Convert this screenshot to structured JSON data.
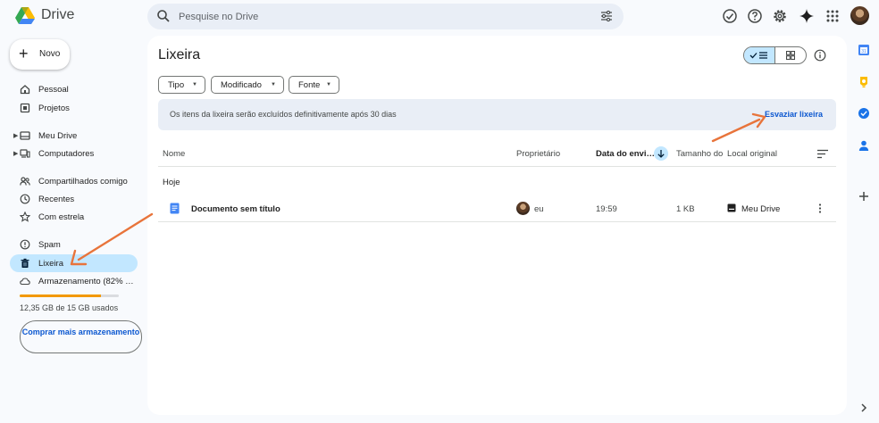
{
  "app": {
    "title": "Drive"
  },
  "search": {
    "placeholder": "Pesquise no Drive"
  },
  "topbar": {
    "icons": [
      "offline-status-icon",
      "help-icon",
      "settings-icon",
      "gemini-sparkle-icon",
      "apps-grid-icon",
      "account-avatar"
    ]
  },
  "sidebar": {
    "new_label": "Novo",
    "items": [
      {
        "label": "Pessoal",
        "icon": "home-icon"
      },
      {
        "label": "Projetos",
        "icon": "workspace-icon"
      },
      {
        "label": "Meu Drive",
        "icon": "my-drive-icon"
      },
      {
        "label": "Computadores",
        "icon": "computers-icon"
      },
      {
        "label": "Compartilhados comigo",
        "icon": "shared-icon"
      },
      {
        "label": "Recentes",
        "icon": "clock-icon"
      },
      {
        "label": "Com estrela",
        "icon": "star-icon"
      },
      {
        "label": "Spam",
        "icon": "spam-icon"
      },
      {
        "label": "Lixeira",
        "icon": "trash-icon"
      },
      {
        "label": "Armazenamento (82% us…",
        "icon": "cloud-icon"
      }
    ],
    "storage_fraction": 0.82,
    "storage_text": "12,35 GB de 15 GB usados",
    "buy_label": "Comprar mais armazenamento"
  },
  "main": {
    "title": "Lixeira",
    "filters": [
      "Tipo",
      "Modificado",
      "Fonte"
    ],
    "banner_text": "Os itens da lixeira serão excluídos definitivamente após 30 dias",
    "banner_button": "Esvaziar lixeira",
    "columns": [
      "Nome",
      "Proprietário",
      "Data do envi…",
      "Tamanho do",
      "Local original"
    ],
    "group": "Hoje",
    "rows": [
      {
        "name": "Documento sem título",
        "owner": "eu",
        "date": "19:59",
        "size": "1 KB",
        "location": "Meu Drive"
      }
    ]
  },
  "colors": {
    "accent": "#0b57d0",
    "selected": "#c2e7ff",
    "arrow": "#e8743b",
    "storage": "#f29900"
  }
}
